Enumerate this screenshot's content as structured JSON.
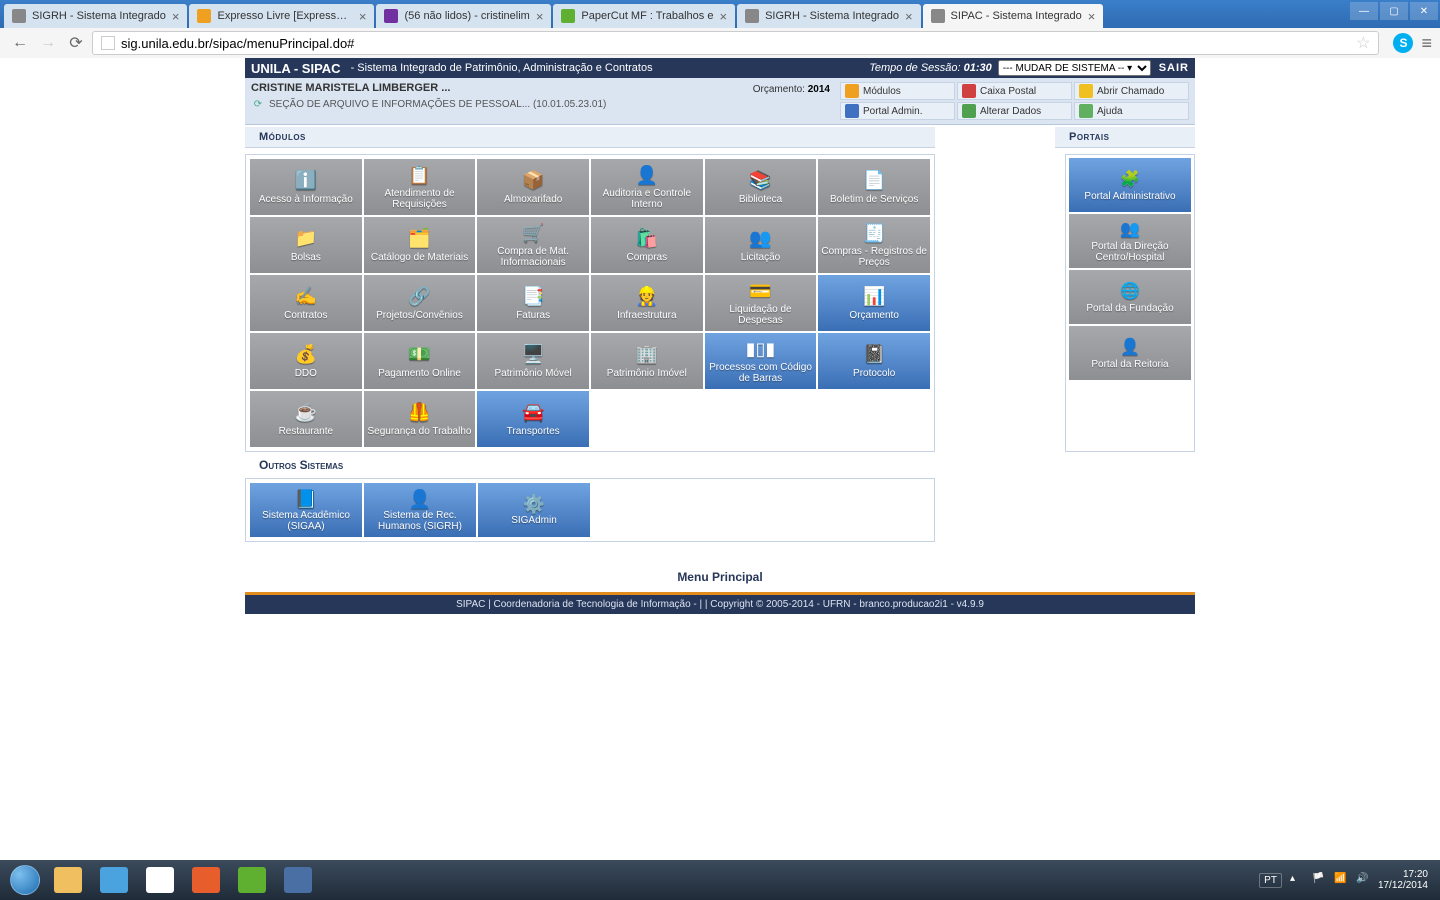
{
  "browser": {
    "tabs": [
      {
        "title": "SIGRH - Sistema Integrado",
        "favicon_color": "#888"
      },
      {
        "title": "Expresso Livre [Expresso M",
        "favicon_color": "#f0a020"
      },
      {
        "title": "(56 não lidos) - cristinelim",
        "favicon_color": "#7030a0"
      },
      {
        "title": "PaperCut MF : Trabalhos e",
        "favicon_color": "#5fb030"
      },
      {
        "title": "SIGRH - Sistema Integrado",
        "favicon_color": "#888"
      },
      {
        "title": "SIPAC - Sistema Integrado",
        "favicon_color": "#888",
        "active": true
      }
    ],
    "url": "sig.unila.edu.br/sipac/menuPrincipal.do#",
    "win_buttons": {
      "min": "—",
      "max": "▢",
      "close": "✕"
    }
  },
  "topbar": {
    "brand": "UNILA - SIPAC",
    "subtitle": "- Sistema Integrado de Patrimônio, Administração e Contratos",
    "session_label": "Tempo de Sessão:",
    "session_value": "01:30",
    "system_select": "--- MUDAR DE SISTEMA -- ▾",
    "sair": "SAIR"
  },
  "infobar": {
    "user": "CRISTINE MARISTELA LIMBERGER ...",
    "dept": "SEÇÃO DE ARQUIVO E INFORMAÇÕES DE PESSOAL... (10.01.05.23.01)",
    "orc_label": "Orçamento:",
    "orc_value": "2014",
    "toolbar": [
      {
        "label": "Módulos",
        "color": "#f0a020"
      },
      {
        "label": "Caixa Postal",
        "color": "#d04040"
      },
      {
        "label": "Abrir Chamado",
        "color": "#f0c020"
      },
      {
        "label": "Portal Admin.",
        "color": "#4070c0"
      },
      {
        "label": "Alterar Dados",
        "color": "#50a050"
      },
      {
        "label": "Ajuda",
        "color": "#60b060"
      }
    ]
  },
  "sections": {
    "modulos": "Módulos",
    "portais": "Portais",
    "outros": "Outros Sistemas",
    "menu_principal": "Menu Principal"
  },
  "modules": [
    {
      "label": "Acesso à Informação",
      "icon": "ℹ️",
      "blue": false
    },
    {
      "label": "Atendimento de Requisições",
      "icon": "📋",
      "blue": false
    },
    {
      "label": "Almoxarifado",
      "icon": "📦",
      "blue": false
    },
    {
      "label": "Auditoria e Controle Interno",
      "icon": "👤",
      "blue": false
    },
    {
      "label": "Biblioteca",
      "icon": "📚",
      "blue": false
    },
    {
      "label": "Boletim de Serviços",
      "icon": "📄",
      "blue": false
    },
    {
      "label": "Bolsas",
      "icon": "📁",
      "blue": false
    },
    {
      "label": "Catálogo de Materiais",
      "icon": "🗂️",
      "blue": false
    },
    {
      "label": "Compra de Mat. Informacionais",
      "icon": "🛒",
      "blue": false
    },
    {
      "label": "Compras",
      "icon": "🛍️",
      "blue": false
    },
    {
      "label": "Licitação",
      "icon": "👥",
      "blue": false
    },
    {
      "label": "Compras - Registros de Preços",
      "icon": "🧾",
      "blue": false
    },
    {
      "label": "Contratos",
      "icon": "✍️",
      "blue": false
    },
    {
      "label": "Projetos/Convênios",
      "icon": "🔗",
      "blue": false
    },
    {
      "label": "Faturas",
      "icon": "📑",
      "blue": false
    },
    {
      "label": "Infraestrutura",
      "icon": "👷",
      "blue": false
    },
    {
      "label": "Liquidação de Despesas",
      "icon": "💳",
      "blue": false
    },
    {
      "label": "Orçamento",
      "icon": "📊",
      "blue": true
    },
    {
      "label": "DDO",
      "icon": "💰",
      "blue": false
    },
    {
      "label": "Pagamento Online",
      "icon": "💵",
      "blue": false
    },
    {
      "label": "Patrimônio Móvel",
      "icon": "🖥️",
      "blue": false
    },
    {
      "label": "Patrimônio Imóvel",
      "icon": "🏢",
      "blue": false
    },
    {
      "label": "Processos com Código de Barras",
      "icon": "▮▯▮",
      "blue": true
    },
    {
      "label": "Protocolo",
      "icon": "📓",
      "blue": true
    },
    {
      "label": "Restaurante",
      "icon": "☕",
      "blue": false
    },
    {
      "label": "Segurança do Trabalho",
      "icon": "🦺",
      "blue": false
    },
    {
      "label": "Transportes",
      "icon": "🚘",
      "blue": true
    }
  ],
  "portals": [
    {
      "label": "Portal Administrativo",
      "icon": "🧩",
      "blue": true
    },
    {
      "label": "Portal da Direção Centro/Hospital",
      "icon": "👥",
      "blue": false
    },
    {
      "label": "Portal da Fundação",
      "icon": "🌐",
      "blue": false
    },
    {
      "label": "Portal da Reitoria",
      "icon": "👤",
      "blue": false
    }
  ],
  "other_systems": [
    {
      "label": "Sistema Acadêmico (SIGAA)",
      "icon": "📘"
    },
    {
      "label": "Sistema de Rec. Humanos (SIGRH)",
      "icon": "👤"
    },
    {
      "label": "SIGAdmin",
      "icon": "⚙️"
    }
  ],
  "footer": "SIPAC | Coordenadoria de Tecnologia de Informação - | | Copyright © 2005-2014 - UFRN - branco.producao2i1 - v4.9.9",
  "taskbar": {
    "icons": [
      {
        "color": "#f0c060"
      },
      {
        "color": "#4aa3df"
      },
      {
        "color": "#ffffff"
      },
      {
        "color": "#e85d2c"
      },
      {
        "color": "#5fb030"
      },
      {
        "color": "#4a6fa5"
      }
    ],
    "lang": "PT",
    "time": "17:20",
    "date": "17/12/2014"
  }
}
